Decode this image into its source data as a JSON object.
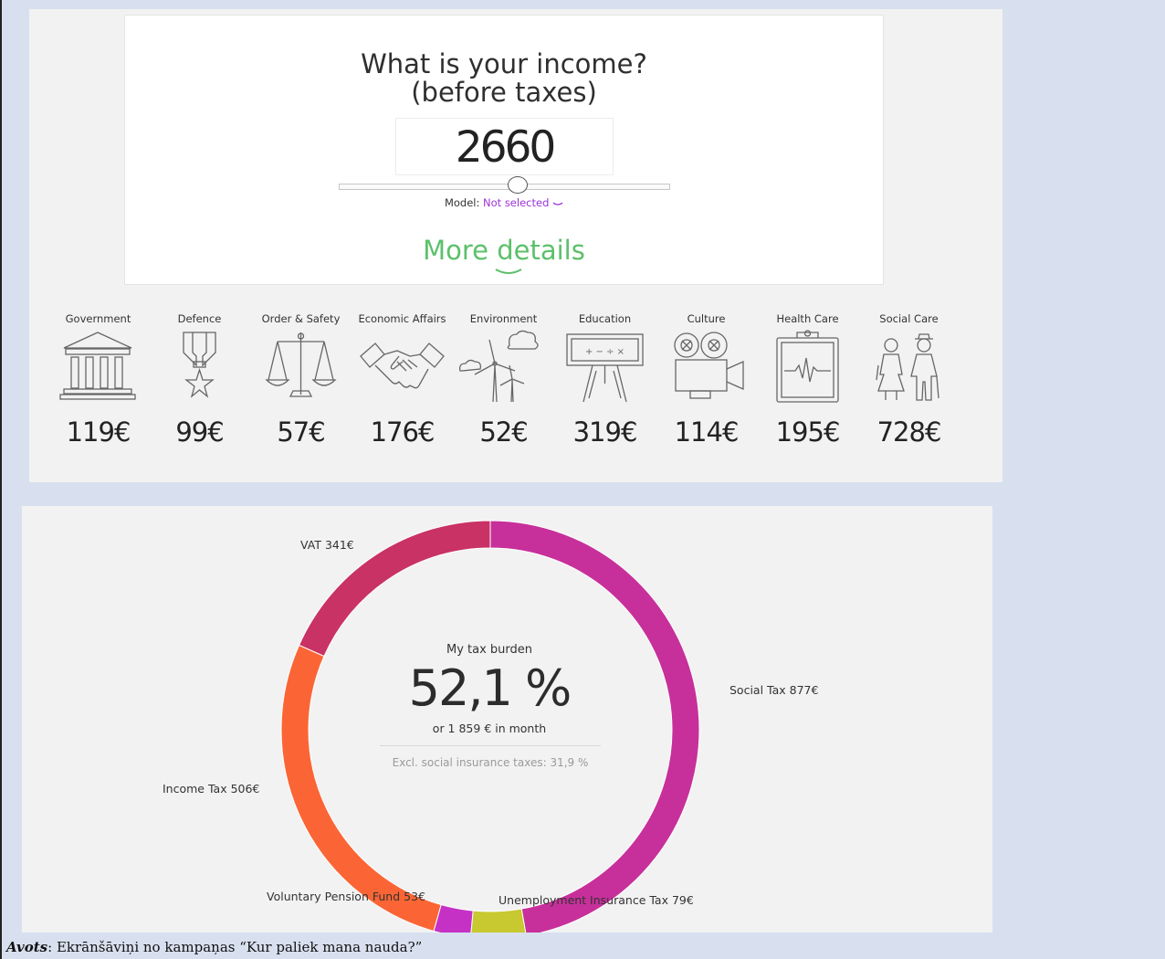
{
  "income_card": {
    "title_line1": "What is your income?",
    "title_line2": "(before taxes)",
    "income_value": "2660",
    "model_label": "Model:",
    "model_value": "Not selected",
    "more_details": "More details"
  },
  "spending_categories": [
    {
      "label": "Government",
      "value": "119€",
      "icon": "government-building-icon"
    },
    {
      "label": "Defence",
      "value": "99€",
      "icon": "medal-icon"
    },
    {
      "label": "Order & Safety",
      "value": "57€",
      "icon": "scales-icon"
    },
    {
      "label": "Economic Affairs",
      "value": "176€",
      "icon": "handshake-icon"
    },
    {
      "label": "Environment",
      "value": "52€",
      "icon": "wind-turbine-icon"
    },
    {
      "label": "Education",
      "value": "319€",
      "icon": "chalkboard-icon"
    },
    {
      "label": "Culture",
      "value": "114€",
      "icon": "film-camera-icon"
    },
    {
      "label": "Health Care",
      "value": "195€",
      "icon": "clipboard-heartbeat-icon"
    },
    {
      "label": "Social Care",
      "value": "728€",
      "icon": "elderly-couple-icon"
    }
  ],
  "tax_burden": {
    "title": "My tax burden",
    "percent": "52,1 %",
    "monthly": "or 1 859 € in month",
    "excl_social": "Excl. social insurance taxes: 31,9 %"
  },
  "chart_data": {
    "type": "pie",
    "segments": [
      {
        "label": "Social Tax 877€",
        "value": 877,
        "color": "#c7309a"
      },
      {
        "label": "Unemployment Insurance Tax 79€",
        "value": 79,
        "color": "#c8c830"
      },
      {
        "label": "Voluntary Pension Fund 53€",
        "value": 53,
        "color": "#c531c5"
      },
      {
        "label": "Income Tax 506€",
        "value": 506,
        "color": "#fb6535"
      },
      {
        "label": "VAT 341€",
        "value": 341,
        "color": "#c93264"
      }
    ]
  },
  "caption": {
    "source_label": "Avots",
    "source_text": ": Ekrānšāviņi no kampaņas “Kur paliek mana nauda?”"
  }
}
